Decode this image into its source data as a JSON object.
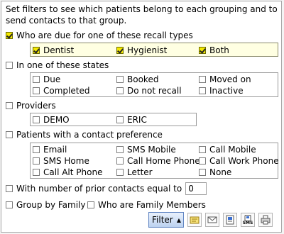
{
  "description": "Set filters to see which patients belong to each grouping and to send contacts to that group.",
  "recall": {
    "label": "Who are due for one of these recall types",
    "checked": true,
    "options": [
      {
        "label": "Dentist",
        "checked": true
      },
      {
        "label": "Hygienist",
        "checked": true
      },
      {
        "label": "Both",
        "checked": true
      }
    ]
  },
  "states": {
    "label": "In one of these states",
    "checked": false,
    "options": [
      {
        "label": "Due",
        "checked": false
      },
      {
        "label": "Booked",
        "checked": false
      },
      {
        "label": "Moved on",
        "checked": false
      },
      {
        "label": "Completed",
        "checked": false
      },
      {
        "label": "Do not recall",
        "checked": false
      },
      {
        "label": "Inactive",
        "checked": false
      }
    ]
  },
  "providers": {
    "label": "Providers",
    "checked": false,
    "options": [
      {
        "label": "DEMO",
        "checked": false
      },
      {
        "label": "ERIC",
        "checked": false
      }
    ]
  },
  "contact_pref": {
    "label": "Patients with a contact preference",
    "checked": false,
    "options": [
      {
        "label": "Email",
        "checked": false
      },
      {
        "label": "SMS Mobile",
        "checked": false
      },
      {
        "label": "Call Mobile",
        "checked": false
      },
      {
        "label": "SMS Home",
        "checked": false
      },
      {
        "label": "Call Home Phone",
        "checked": false
      },
      {
        "label": "Call Work Phone",
        "checked": false
      },
      {
        "label": "Call Alt Phone",
        "checked": false
      },
      {
        "label": "Letter",
        "checked": false
      },
      {
        "label": "None",
        "checked": false
      }
    ]
  },
  "prior_contacts": {
    "label": "With number of prior contacts equal to",
    "checked": false,
    "value": "0"
  },
  "group_by_family": {
    "label": "Group by Family",
    "checked": false
  },
  "family_members": {
    "label": "Who are Family Members",
    "checked": false
  },
  "toolbar": {
    "filter_label": "Filter",
    "sms_label": "SMS",
    "icons": [
      "label-print-icon",
      "envelope-icon",
      "mail-merge-icon",
      "sms-icon",
      "printer-icon"
    ]
  }
}
